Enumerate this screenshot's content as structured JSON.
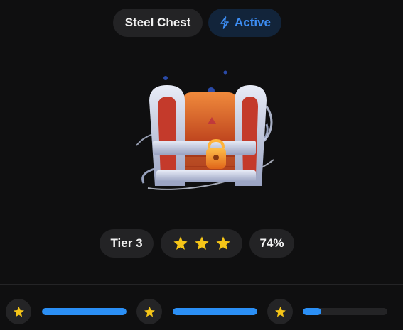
{
  "header": {
    "title": "Steel Chest",
    "status_label": "Active",
    "status_icon": "lightning-icon",
    "status_color": "#3d8ef5"
  },
  "item": {
    "name": "Steel Chest",
    "image_icon": "treasure-chest-icon"
  },
  "stats": {
    "tier": "Tier 3",
    "stars": 3,
    "percent": "74%"
  },
  "progress": {
    "slots": [
      {
        "icon": "star-icon",
        "fill": 1.0
      },
      {
        "icon": "star-icon",
        "fill": 1.0
      },
      {
        "icon": "star-icon",
        "fill": 0.22
      }
    ],
    "fill_color": "#2b8ff5"
  },
  "colors": {
    "background": "#0f0f10",
    "pill": "#232325",
    "star": "#f5c518"
  }
}
